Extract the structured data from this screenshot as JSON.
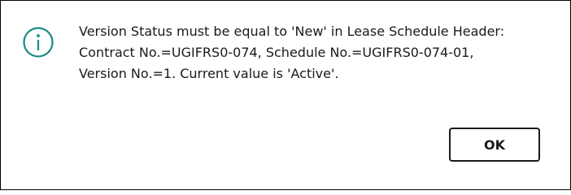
{
  "dialog": {
    "icon": "info-circle-icon",
    "icon_color": "#1a8a84",
    "message_lines": [
      "Version Status must be equal to 'New' in Lease Schedule Header:",
      "Contract No.=UGIFRS0-074, Schedule No.=UGIFRS0-074-01,",
      "Version No.=1. Current value is 'Active'."
    ],
    "ok_label": "OK"
  }
}
